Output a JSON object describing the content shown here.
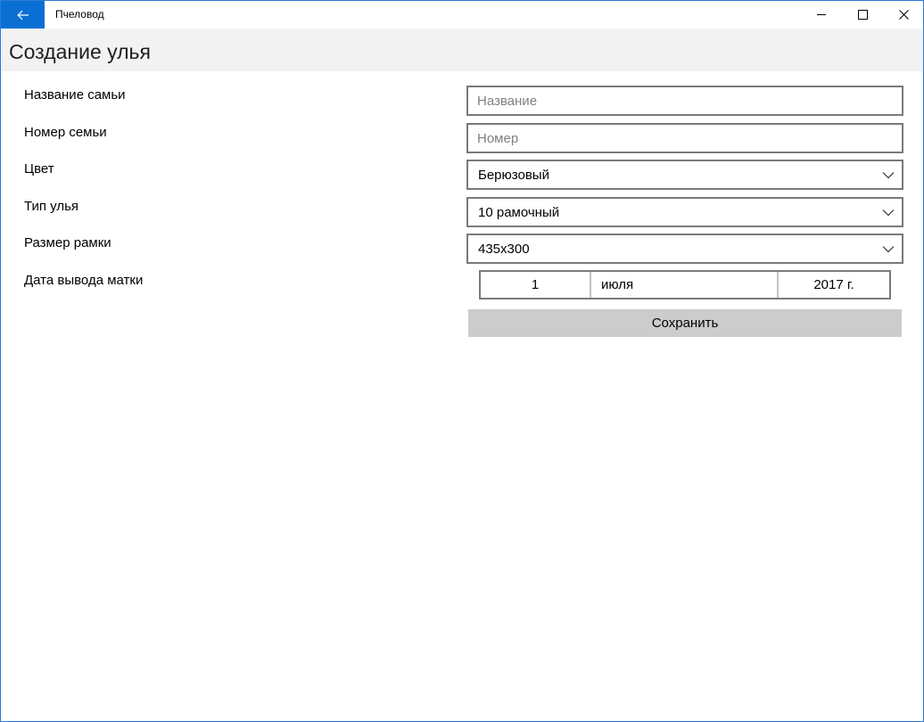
{
  "window": {
    "title": "Пчеловод"
  },
  "page": {
    "title": "Создание улья"
  },
  "form": {
    "family_name": {
      "label": "Название самьи",
      "value": "",
      "placeholder": "Название"
    },
    "family_number": {
      "label": "Номер семьи",
      "value": "",
      "placeholder": "Номер"
    },
    "color": {
      "label": "Цвет",
      "selected": "Берюзовый"
    },
    "hive_type": {
      "label": "Тип улья",
      "selected": "10 рамочный"
    },
    "frame_size": {
      "label": "Размер рамки",
      "selected": "435x300"
    },
    "queen_date": {
      "label": "Дата вывода матки",
      "day": "1",
      "month": "июля",
      "year": "2017 г."
    },
    "save_label": "Сохранить"
  },
  "icons": {
    "back": "back-arrow-icon",
    "minimize": "minimize-icon",
    "maximize": "maximize-icon",
    "close": "close-icon",
    "dropdown": "chevron-down-icon"
  },
  "colors": {
    "accent": "#0a6fd3",
    "header_band": "#f2f2f2",
    "field_border": "#7a7a7a",
    "button_bg": "#cccccc"
  }
}
